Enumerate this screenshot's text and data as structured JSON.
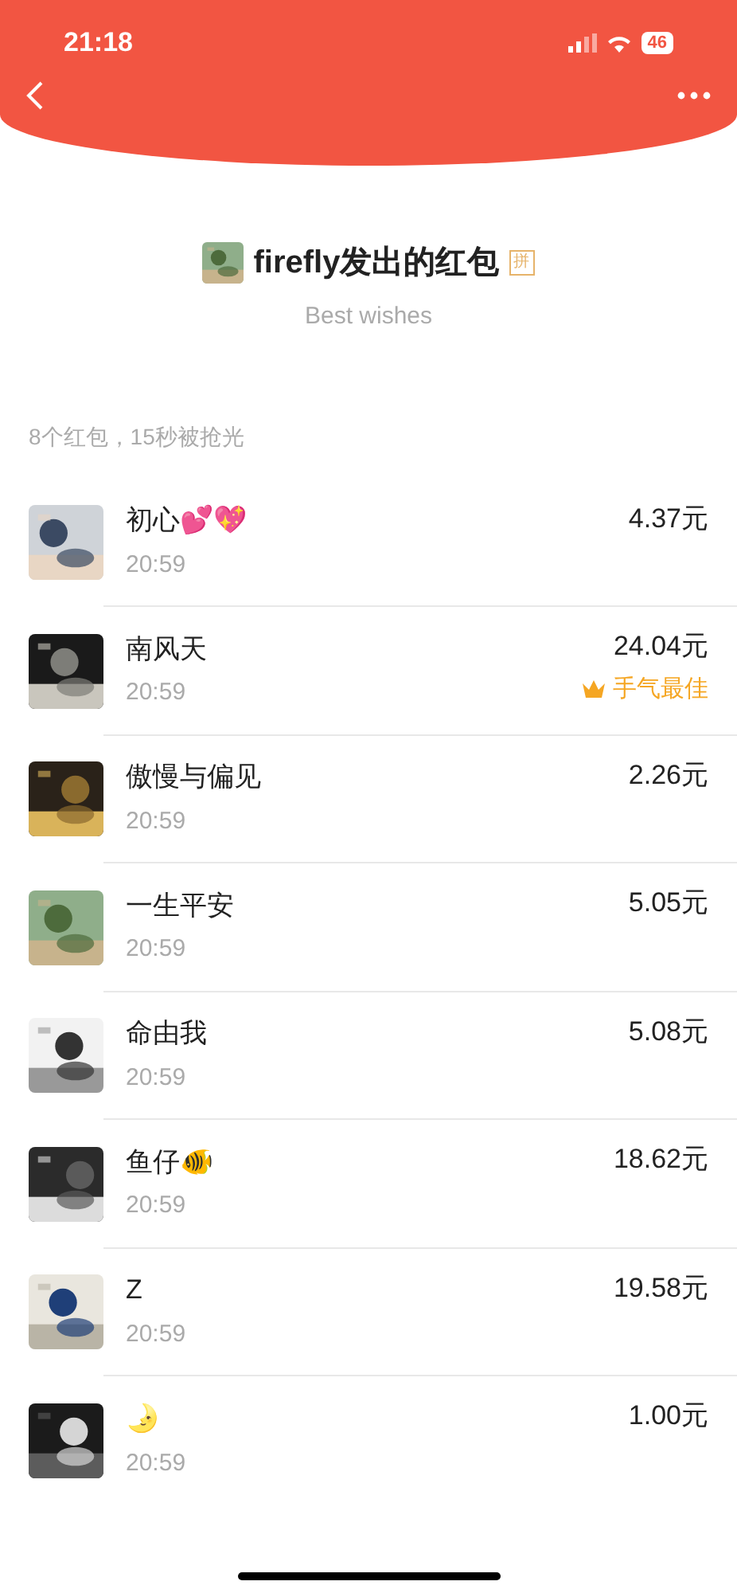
{
  "status_bar": {
    "time": "21:18",
    "battery": "46"
  },
  "header": {
    "title": "firefly发出的红包",
    "tag": "拼",
    "subtitle": "Best wishes"
  },
  "summary": "8个红包，15秒被抢光",
  "best_label": "手气最佳",
  "rows": [
    {
      "name": "初心💕💖",
      "time": "20:59",
      "amount": "4.37元",
      "best_luck": false
    },
    {
      "name": "南风天",
      "time": "20:59",
      "amount": "24.04元",
      "best_luck": true
    },
    {
      "name": "傲慢与偏见",
      "time": "20:59",
      "amount": "2.26元",
      "best_luck": false
    },
    {
      "name": "一生平安",
      "time": "20:59",
      "amount": "5.05元",
      "best_luck": false
    },
    {
      "name": "命由我",
      "time": "20:59",
      "amount": "5.08元",
      "best_luck": false
    },
    {
      "name": "鱼仔🐠",
      "time": "20:59",
      "amount": "18.62元",
      "best_luck": false
    },
    {
      "name": "Z",
      "time": "20:59",
      "amount": "19.58元",
      "best_luck": false
    },
    {
      "name": "🌛",
      "time": "20:59",
      "amount": "1.00元",
      "best_luck": false
    }
  ]
}
